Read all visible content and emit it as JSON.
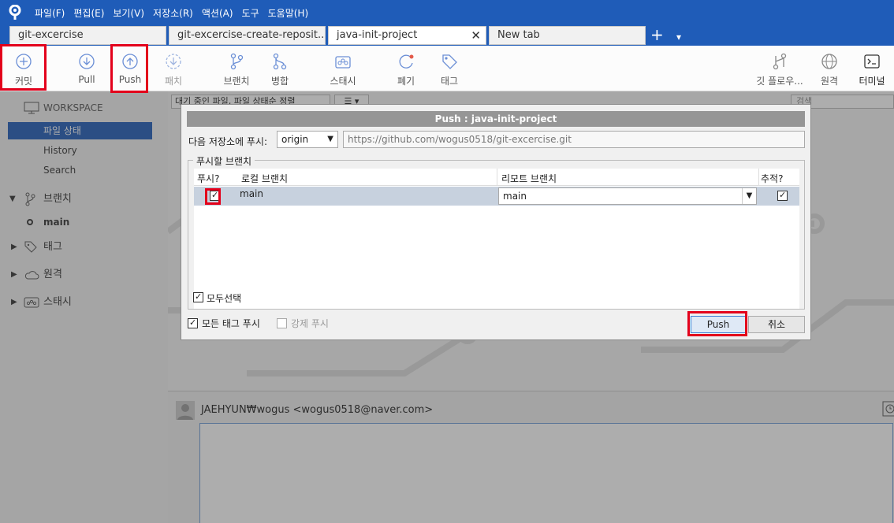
{
  "menubar": {
    "items": [
      "파일(F)",
      "편집(E)",
      "보기(V)",
      "저장소(R)",
      "액션(A)",
      "도구",
      "도움말(H)"
    ]
  },
  "tabs": {
    "items": [
      "git-excercise",
      "git-excercise-create-reposit...",
      "java-init-project",
      "New tab"
    ],
    "close_glyph": "✕",
    "add_glyph": "+",
    "menu_glyph": "▾"
  },
  "toolbar": {
    "commit": "커밋",
    "pull": "Pull",
    "push": "Push",
    "patch": "패치",
    "branch": "브랜치",
    "merge": "병합",
    "stash": "스태시",
    "discard": "폐기",
    "tag": "태그",
    "gitflow": "깃 플로우...",
    "remote": "원격",
    "terminal": "터미널"
  },
  "sidebar": {
    "workspace": "WORKSPACE",
    "file_status": "파일 상태",
    "history": "History",
    "search": "Search",
    "branches": "브랜치",
    "current_branch": "main",
    "tags": "태그",
    "remotes": "원격",
    "stashes": "스태시"
  },
  "main": {
    "filter_label": "대기 중인 파일, 파일 상태순 정렬",
    "search_placeholder": "검색",
    "author": "JAEHYUN₩wogus <wogus0518@naver.com>"
  },
  "dialog": {
    "title": "Push :  java-init-project",
    "push_to_label": "다음 저장소에 푸시:",
    "remote_name": "origin",
    "remote_url": "https://github.com/wogus0518/git-excercise.git",
    "branches_group": "푸시할 브랜치",
    "col_push": "푸시?",
    "col_local": "로컬 브랜치",
    "col_remote": "리모트 브랜치",
    "col_track": "추적?",
    "row_local": "main",
    "row_remote": "main",
    "select_all": "모두선택",
    "push_tags": "모든 태그 푸시",
    "force_push": "강제 푸시",
    "push_button": "Push",
    "cancel_button": "취소"
  },
  "colors": {
    "titlebar": "#1f5cb8",
    "selection": "#1f5cb8",
    "highlight_box": "#e3001b"
  }
}
